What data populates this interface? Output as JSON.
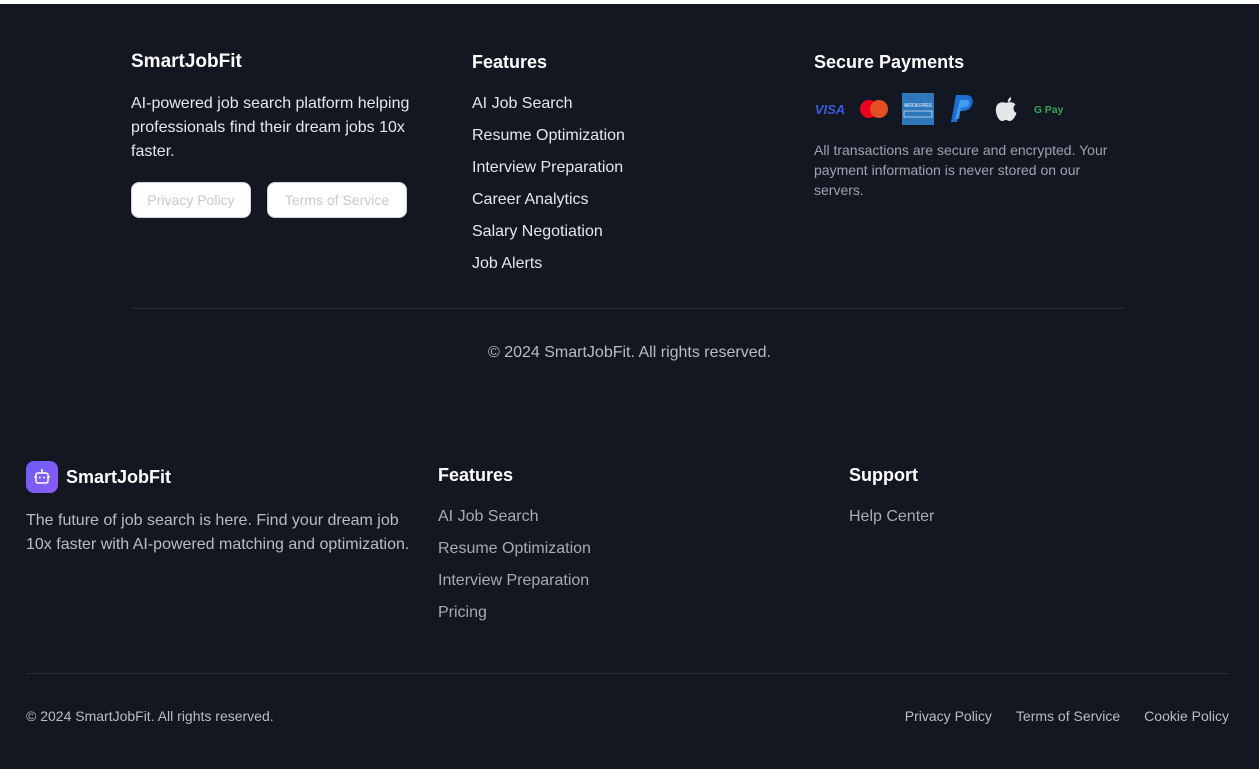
{
  "footer_top": {
    "brand": {
      "title": "SmartJobFit",
      "description": "AI-powered job search platform helping professionals find their dream jobs 10x faster.",
      "privacy_label": "Privacy Policy",
      "terms_label": "Terms of Service"
    },
    "features": {
      "heading": "Features",
      "links": [
        "AI Job Search",
        "Resume Optimization",
        "Interview Preparation",
        "Career Analytics",
        "Salary Negotiation",
        "Job Alerts"
      ]
    },
    "payments": {
      "heading": "Secure Payments",
      "icons": [
        "visa-icon",
        "mastercard-icon",
        "amex-icon",
        "paypal-icon",
        "apple-pay-icon",
        "google-pay-icon"
      ],
      "visa_text": "VISA",
      "amex_text": "AMERICAN EXPRESS",
      "gpay_text": "G Pay",
      "note": "All transactions are secure and encrypted. Your payment information is never stored on our servers."
    },
    "copyright": "© 2024 SmartJobFit. All rights reserved."
  },
  "footer_bottom": {
    "brand": {
      "title": "SmartJobFit",
      "logo_icon": "robot-icon",
      "description": "The future of job search is here. Find your dream job 10x faster with AI-powered matching and optimization."
    },
    "features": {
      "heading": "Features",
      "links": [
        "AI Job Search",
        "Resume Optimization",
        "Interview Preparation",
        "Pricing"
      ]
    },
    "support": {
      "heading": "Support",
      "links": [
        "Help Center"
      ]
    },
    "copyright": "© 2024 SmartJobFit. All rights reserved.",
    "legal_links": [
      "Privacy Policy",
      "Terms of Service",
      "Cookie Policy"
    ]
  },
  "colors": {
    "background": "#131722",
    "brand_gradient_start": "#6d5cf6",
    "visa": "#1a1f71",
    "mastercard_red": "#eb001b",
    "amex": "#2e77bb",
    "paypal": "#1c6fd1",
    "gpay_green": "#34a853"
  }
}
